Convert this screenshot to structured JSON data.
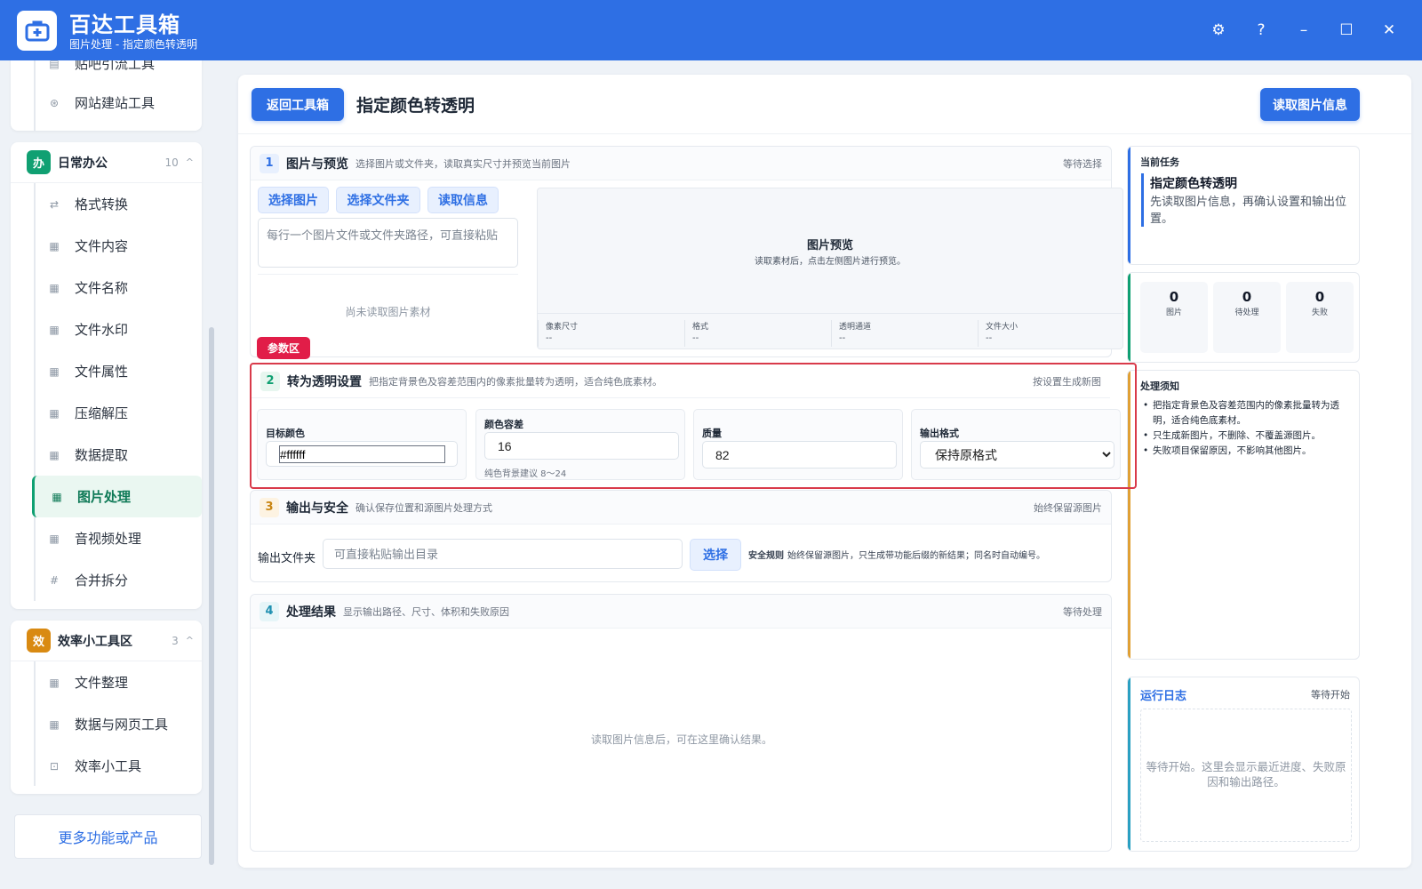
{
  "app": {
    "title": "百达工具箱",
    "subtitle": "图片处理 - 指定颜色转透明"
  },
  "window_controls": {
    "settings": "⚙",
    "help": "?",
    "minimize": "–",
    "maximize": "☐",
    "close": "✕"
  },
  "sidebar": {
    "prev_group_items": [
      {
        "label": "贴吧引流工具",
        "icon": "document-icon"
      },
      {
        "label": "网站建站工具",
        "icon": "globe-icon"
      }
    ],
    "office": {
      "badge": "办",
      "name": "日常办公",
      "count": "10",
      "items": [
        {
          "label": "格式转换",
          "icon": "swap-icon"
        },
        {
          "label": "文件内容",
          "icon": "grid-icon"
        },
        {
          "label": "文件名称",
          "icon": "grid-icon"
        },
        {
          "label": "文件水印",
          "icon": "grid-icon"
        },
        {
          "label": "文件属性",
          "icon": "grid-icon"
        },
        {
          "label": "压缩解压",
          "icon": "grid-icon"
        },
        {
          "label": "数据提取",
          "icon": "grid-icon"
        },
        {
          "label": "图片处理",
          "icon": "grid-icon",
          "active": true
        },
        {
          "label": "音视频处理",
          "icon": "grid-icon"
        },
        {
          "label": "合并拆分",
          "icon": "hash-icon"
        }
      ]
    },
    "efficiency": {
      "badge": "效",
      "name": "效率小工具区",
      "count": "3",
      "items": [
        {
          "label": "文件整理",
          "icon": "grid-icon"
        },
        {
          "label": "数据与网页工具",
          "icon": "grid-icon"
        },
        {
          "label": "效率小工具",
          "icon": "toolbox-icon"
        }
      ]
    },
    "more_label": "更多功能或产品"
  },
  "header": {
    "back_label": "返回工具箱",
    "title": "指定颜色转透明",
    "read_info_label": "读取图片信息"
  },
  "section1": {
    "num": "1",
    "title": "图片与预览",
    "desc": "选择图片或文件夹，读取真实尺寸并预览当前图片",
    "status": "等待选择",
    "select_image": "选择图片",
    "select_folder": "选择文件夹",
    "read_info": "读取信息",
    "path_placeholder": "每行一个图片文件或文件夹路径，可直接粘贴",
    "empty": "尚未读取图片素材",
    "preview_title": "图片预览",
    "preview_hint": "读取素材后，点击左侧图片进行预览。",
    "meta": [
      {
        "k": "像素尺寸",
        "v": "--"
      },
      {
        "k": "格式",
        "v": "--"
      },
      {
        "k": "透明通道",
        "v": "--"
      },
      {
        "k": "文件大小",
        "v": "--"
      }
    ]
  },
  "param_tag": "参数区",
  "section2": {
    "num": "2",
    "title": "转为透明设置",
    "desc": "把指定背景色及容差范围内的像素批量转为透明，适合纯色底素材。",
    "status": "按设置生成新图",
    "target_color_label": "目标颜色",
    "target_color_value": "#ffffff",
    "tolerance_label": "颜色容差",
    "tolerance_value": "16",
    "tolerance_hint": "纯色背景建议 8～24",
    "quality_label": "质量",
    "quality_value": "82",
    "format_label": "输出格式",
    "format_value": "保持原格式"
  },
  "section3": {
    "num": "3",
    "title": "输出与安全",
    "desc": "确认保存位置和源图片处理方式",
    "status": "始终保留源图片",
    "folder_label": "输出文件夹",
    "folder_placeholder": "可直接粘贴输出目录",
    "choose_label": "选择",
    "safety_title": "安全规则",
    "safety_text": "始终保留源图片，只生成带功能后缀的新结果；同名时自动编号。"
  },
  "section4": {
    "num": "4",
    "title": "处理结果",
    "desc": "显示输出路径、尺寸、体积和失败原因",
    "status": "等待处理",
    "empty": "读取图片信息后，可在这里确认结果。"
  },
  "task": {
    "heading": "当前任务",
    "name": "指定颜色转透明",
    "desc": "先读取图片信息，再确认设置和输出位置。"
  },
  "stats": [
    {
      "n": "0",
      "k": "图片"
    },
    {
      "n": "0",
      "k": "待处理"
    },
    {
      "n": "0",
      "k": "失败"
    }
  ],
  "notice": {
    "heading": "处理须知",
    "items": [
      "把指定背景色及容差范围内的像素批量转为透明，适合纯色底素材。",
      "只生成新图片，不删除、不覆盖源图片。",
      "失败项目保留原因，不影响其他图片。"
    ]
  },
  "log": {
    "heading": "运行日志",
    "status": "等待开始",
    "body": "等待开始。这里会显示最近进度、失败原因和输出路径。"
  },
  "colors": {
    "brand": "#2e6fe4",
    "accent_green": "#10a072",
    "alert_red": "#d93a4a",
    "accent_orange": "#e0a035"
  }
}
